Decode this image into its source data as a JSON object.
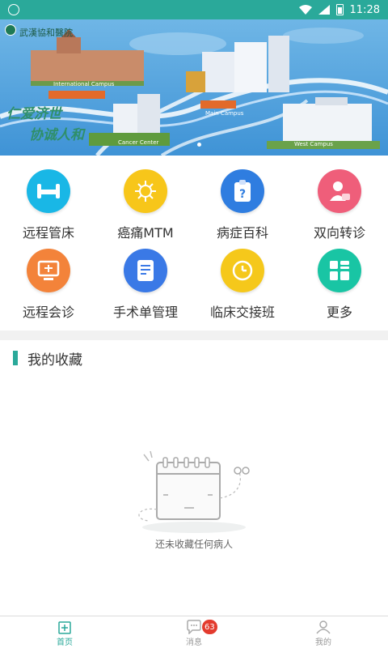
{
  "status_bar": {
    "time": "11:28"
  },
  "banner": {
    "hospital_name": "武漢協和醫院",
    "slogan_line1": "仁爱济世",
    "slogan_line2": "协诚人和",
    "campus_labels": {
      "international": "International Campus",
      "main": "Main Campus",
      "cancer": "Cancer Center",
      "west": "West Campus"
    }
  },
  "grid": {
    "items": [
      {
        "label": "远程管床",
        "icon": "bed-icon",
        "color": "#19b7e6"
      },
      {
        "label": "癌痛MTM",
        "icon": "virus-icon",
        "color": "#f7c61a"
      },
      {
        "label": "病症百科",
        "icon": "clipboard-question-icon",
        "color": "#2f7de0"
      },
      {
        "label": "双向转诊",
        "icon": "user-transfer-icon",
        "color": "#ef5e7a"
      },
      {
        "label": "远程会诊",
        "icon": "monitor-icon",
        "color": "#f3833a"
      },
      {
        "label": "手术单管理",
        "icon": "document-icon",
        "color": "#3a79e6"
      },
      {
        "label": "临床交接班",
        "icon": "clock-refresh-icon",
        "color": "#f5c81b"
      },
      {
        "label": "更多",
        "icon": "grid-more-icon",
        "color": "#19c5a4"
      }
    ]
  },
  "favorites": {
    "title": "我的收藏",
    "empty_text": "还未收藏任何病人"
  },
  "bottom_nav": {
    "home": "首页",
    "messages": "消息",
    "messages_badge": "63",
    "mine": "我的"
  },
  "colors": {
    "accent": "#2aa99a",
    "badge": "#e33b2e"
  }
}
